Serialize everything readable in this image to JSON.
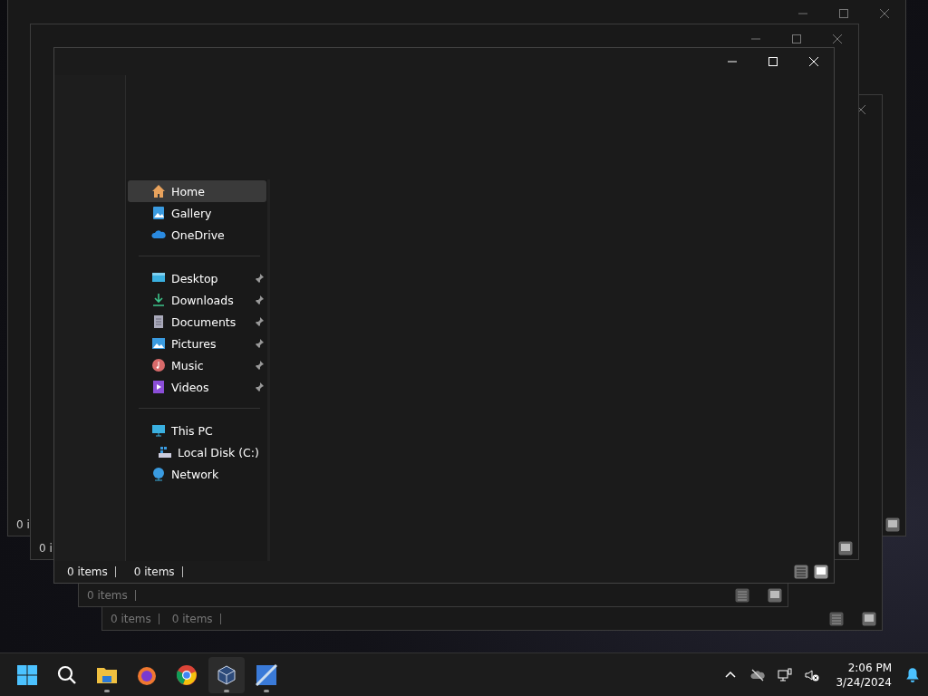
{
  "back_windows": [
    {
      "status": [
        "0 i"
      ]
    },
    {
      "status": [
        "0 items",
        "0 items"
      ]
    },
    {
      "status": [
        "0 items"
      ]
    },
    {
      "status": [
        "0 i"
      ]
    }
  ],
  "window": {
    "status_left": "0 items",
    "status_right": "0 items"
  },
  "sidebar": {
    "groups": [
      {
        "items": [
          {
            "label": "Home",
            "selected": true,
            "pinned": false
          },
          {
            "label": "Gallery",
            "selected": false,
            "pinned": false
          },
          {
            "label": "OneDrive",
            "selected": false,
            "pinned": false
          }
        ]
      },
      {
        "items": [
          {
            "label": "Desktop",
            "selected": false,
            "pinned": true
          },
          {
            "label": "Downloads",
            "selected": false,
            "pinned": true
          },
          {
            "label": "Documents",
            "selected": false,
            "pinned": true
          },
          {
            "label": "Pictures",
            "selected": false,
            "pinned": true
          },
          {
            "label": "Music",
            "selected": false,
            "pinned": true
          },
          {
            "label": "Videos",
            "selected": false,
            "pinned": true
          }
        ]
      },
      {
        "items": [
          {
            "label": "This PC",
            "selected": false,
            "pinned": false,
            "children": [
              {
                "label": "Local Disk (C:)",
                "selected": false,
                "pinned": false
              }
            ]
          },
          {
            "label": "Network",
            "selected": false,
            "pinned": false
          }
        ]
      }
    ]
  },
  "taskbar": {
    "apps": [
      {
        "selected": false,
        "running": false
      },
      {
        "selected": false,
        "running": false
      },
      {
        "selected": false,
        "running": true
      },
      {
        "selected": false,
        "running": false
      },
      {
        "selected": false,
        "running": false
      },
      {
        "selected": true,
        "running": true
      },
      {
        "selected": false,
        "running": true
      }
    ],
    "time": "2:06 PM",
    "date": "3/24/2024"
  }
}
